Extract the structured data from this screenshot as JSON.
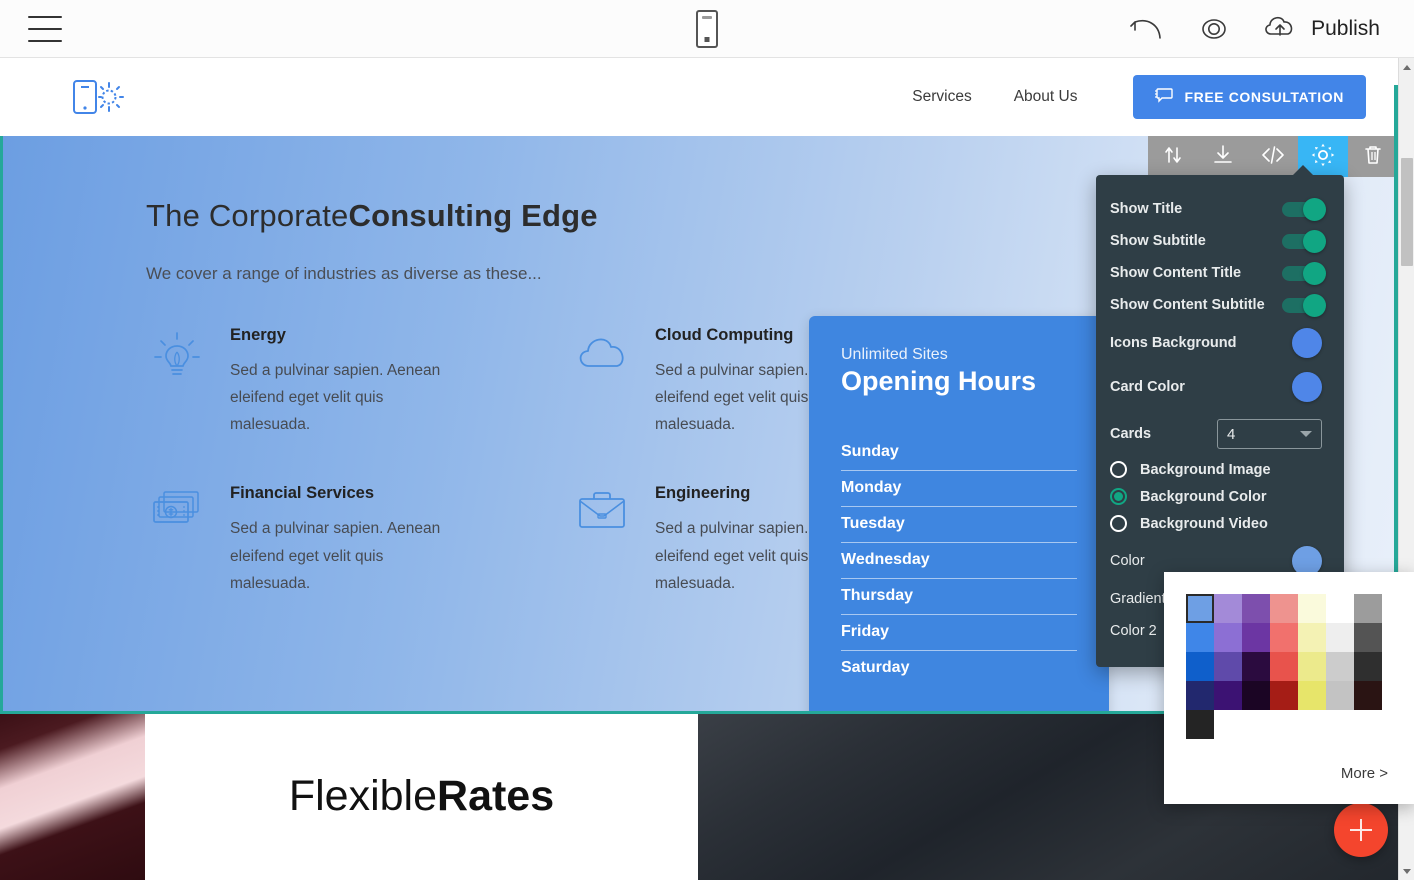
{
  "editor": {
    "menu_icon": "hamburger-icon",
    "device_preview_icon": "mobile-device-icon",
    "undo_icon": "undo-arrow-icon",
    "preview_icon": "eye-icon",
    "publish_icon": "cloud-upload-icon",
    "publish_label": "Publish"
  },
  "block_toolbar": {
    "move_label": "move-block",
    "download_label": "download-block",
    "code_label": "edit-code",
    "settings_label": "block-settings",
    "delete_label": "delete-block"
  },
  "site_header": {
    "logo_icon": "phone-brightness-logo",
    "nav": [
      {
        "label": "Services"
      },
      {
        "label": "About Us"
      }
    ],
    "cta": {
      "label": "FREE CONSULTATION",
      "icon": "chat-bubble-icon",
      "color": "#4285e8"
    }
  },
  "hero": {
    "title_light": "The Corporate",
    "title_bold": "Consulting Edge",
    "subtitle": "We cover a range of industries as diverse as these...",
    "gradient_from": "#6c9ee2",
    "gradient_to": "#e9f0fa",
    "border_color": "#25a899",
    "features": [
      {
        "icon": "lightbulb-icon",
        "title": "Energy",
        "text": "Sed a pulvinar sapien. Aenean eleifend eget velit quis malesuada."
      },
      {
        "icon": "cloud-icon",
        "title": "Cloud Computing",
        "text": "Sed a pulvinar sapien. Aenean eleifend eget velit quis malesuada."
      },
      {
        "icon": "money-icon",
        "title": "Financial Services",
        "text": "Sed a pulvinar sapien. Aenean eleifend eget velit quis malesuada."
      },
      {
        "icon": "briefcase-icon",
        "title": "Engineering",
        "text": "Sed a pulvinar sapien. Aenean eleifend eget velit quis malesuada."
      }
    ]
  },
  "hours_card": {
    "subtitle": "Unlimited Sites",
    "title": "Opening Hours",
    "color": "#3f86e0",
    "days": [
      {
        "label": "Sunday"
      },
      {
        "label": "Monday"
      },
      {
        "label": "Tuesday"
      },
      {
        "label": "Wednesday"
      },
      {
        "label": "Thursday"
      },
      {
        "label": "Friday"
      },
      {
        "label": "Saturday"
      }
    ]
  },
  "lower_section": {
    "title_light": "Flexible",
    "title_bold": "Rates"
  },
  "settings_panel": {
    "toggles": [
      {
        "label": "Show Title",
        "on": true
      },
      {
        "label": "Show Subtitle",
        "on": true
      },
      {
        "label": "Show Content Title",
        "on": true
      },
      {
        "label": "Show Content Subtitle",
        "on": true
      }
    ],
    "colors": [
      {
        "label": "Icons Background",
        "value": "#4f86e8"
      },
      {
        "label": "Card Color",
        "value": "#4f86e8"
      }
    ],
    "cards": {
      "label": "Cards",
      "value": "4"
    },
    "background_options": [
      {
        "label": "Background Image",
        "selected": false
      },
      {
        "label": "Background Color",
        "selected": true
      },
      {
        "label": "Background Video",
        "selected": false
      }
    ],
    "color_row": {
      "label": "Color",
      "value": "#6e9fe4"
    },
    "gradient_row": {
      "label": "Gradient"
    },
    "color2_row": {
      "label": "Color 2"
    },
    "accent_on": "#11a683"
  },
  "color_picker": {
    "more_label": "More >",
    "selected_index": 0,
    "swatches": [
      "#6e9fe4",
      "#a38ad8",
      "#7d4fad",
      "#ee938f",
      "#fafadc",
      "#ffffff",
      "#9c9c9c",
      "#3f86e8",
      "#8c6fd4",
      "#6c36a3",
      "#f1716d",
      "#f4f2b4",
      "#eeeeee",
      "#545454",
      "#0f5fcb",
      "#5f4aaa",
      "#2b0b3f",
      "#e8534c",
      "#ecea8c",
      "#cccccc",
      "#2f2f2f",
      "#22286e",
      "#3c1273",
      "#1b0524",
      "#a51d16",
      "#e7e56a",
      "#c3c3c3",
      "#2a1413",
      "#242424"
    ]
  },
  "fab": {
    "icon": "plus-icon",
    "color": "#f4452d"
  }
}
